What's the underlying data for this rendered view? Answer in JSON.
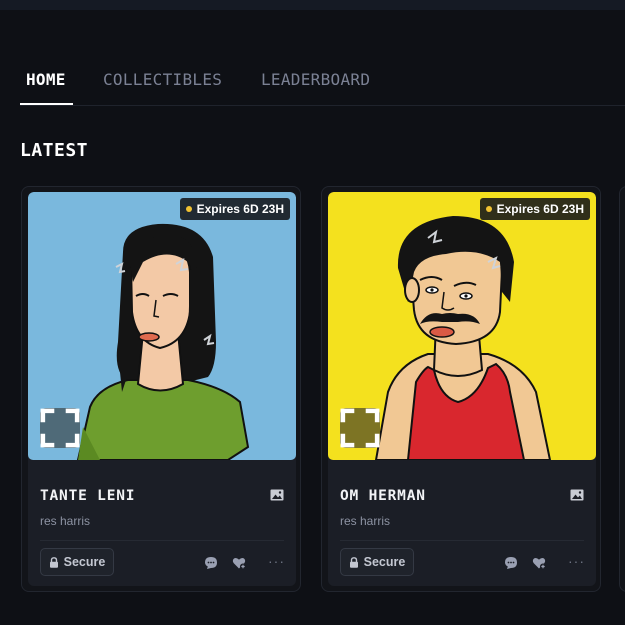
{
  "tabs": [
    {
      "label": "HOME",
      "active": true
    },
    {
      "label": "COLLECTIBLES",
      "active": false
    },
    {
      "label": "LEADERBOARD",
      "active": false
    }
  ],
  "section": {
    "title": "LATEST"
  },
  "cards": [
    {
      "title": "TANTE LENI",
      "creator": "res harris",
      "expires": "Expires 6D 23H",
      "secure_label": "Secure",
      "more_label": "···",
      "image_bg": "#7ab8dd",
      "expand_bg": "#4f6a78"
    },
    {
      "title": "OM HERMAN",
      "creator": "res harris",
      "expires": "Expires 6D 23H",
      "secure_label": "Secure",
      "more_label": "···",
      "image_bg": "#f4e11e",
      "expand_bg": "#7d7424"
    }
  ],
  "colors": {
    "background": "#0e1015",
    "card": "#1b1e26",
    "expires_dot": "#f1c232",
    "tab_inactive": "#7b8194"
  },
  "icons": [
    "expand-icon",
    "image-icon",
    "lock-icon",
    "comment-icon",
    "heart-plus-icon",
    "more-icon"
  ]
}
